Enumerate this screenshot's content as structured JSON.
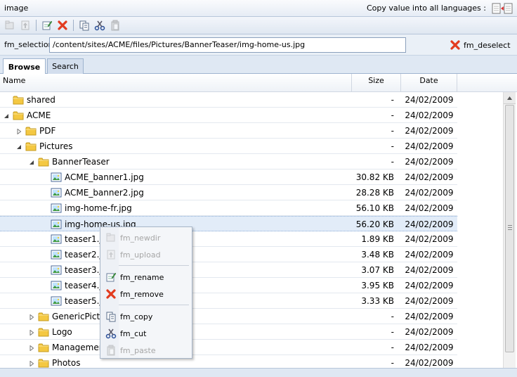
{
  "title": "image",
  "copy_languages_label": "Copy value into all languages :",
  "selection": {
    "label": "fm_selection",
    "value": "/content/sites/ACME/files/Pictures/BannerTeaser/img-home-us.jpg",
    "deselect_label": "fm_deselect"
  },
  "tabs": [
    {
      "label": "Browse"
    },
    {
      "label": "Search"
    }
  ],
  "columns": {
    "name": "Name",
    "size": "Size",
    "date": "Date"
  },
  "rows": [
    {
      "name": "shared",
      "size": "-",
      "date": "24/02/2009",
      "type": "folder",
      "depth": 0,
      "expander": "none"
    },
    {
      "name": "ACME",
      "size": "-",
      "date": "24/02/2009",
      "type": "folder",
      "depth": 0,
      "expander": "expanded"
    },
    {
      "name": "PDF",
      "size": "-",
      "date": "24/02/2009",
      "type": "folder",
      "depth": 1,
      "expander": "collapsed"
    },
    {
      "name": "Pictures",
      "size": "-",
      "date": "24/02/2009",
      "type": "folder",
      "depth": 1,
      "expander": "expanded"
    },
    {
      "name": "BannerTeaser",
      "size": "-",
      "date": "24/02/2009",
      "type": "folder",
      "depth": 2,
      "expander": "expanded"
    },
    {
      "name": "ACME_banner1.jpg",
      "size": "30.82 KB",
      "date": "24/02/2009",
      "type": "image",
      "depth": 3,
      "expander": "none"
    },
    {
      "name": "ACME_banner2.jpg",
      "size": "28.28 KB",
      "date": "24/02/2009",
      "type": "image",
      "depth": 3,
      "expander": "none"
    },
    {
      "name": "img-home-fr.jpg",
      "size": "56.10 KB",
      "date": "24/02/2009",
      "type": "image",
      "depth": 3,
      "expander": "none"
    },
    {
      "name": "img-home-us.jpg",
      "size": "56.20 KB",
      "date": "24/02/2009",
      "type": "image",
      "depth": 3,
      "expander": "none",
      "selected": true
    },
    {
      "name": "teaser1.jpg",
      "size": "1.89 KB",
      "date": "24/02/2009",
      "type": "image",
      "depth": 3,
      "expander": "none"
    },
    {
      "name": "teaser2.jpg",
      "size": "3.48 KB",
      "date": "24/02/2009",
      "type": "image",
      "depth": 3,
      "expander": "none"
    },
    {
      "name": "teaser3.jpg",
      "size": "3.07 KB",
      "date": "24/02/2009",
      "type": "image",
      "depth": 3,
      "expander": "none"
    },
    {
      "name": "teaser4.jpg",
      "size": "3.95 KB",
      "date": "24/02/2009",
      "type": "image",
      "depth": 3,
      "expander": "none"
    },
    {
      "name": "teaser5.jpg",
      "size": "3.33 KB",
      "date": "24/02/2009",
      "type": "image",
      "depth": 3,
      "expander": "none"
    },
    {
      "name": "GenericPictures",
      "size": "-",
      "date": "24/02/2009",
      "type": "folder",
      "depth": 2,
      "expander": "collapsed"
    },
    {
      "name": "Logo",
      "size": "-",
      "date": "24/02/2009",
      "type": "folder",
      "depth": 2,
      "expander": "collapsed"
    },
    {
      "name": "Management",
      "size": "-",
      "date": "24/02/2009",
      "type": "folder",
      "depth": 2,
      "expander": "collapsed"
    },
    {
      "name": "Photos",
      "size": "-",
      "date": "24/02/2009",
      "type": "folder",
      "depth": 2,
      "expander": "collapsed"
    }
  ],
  "context_menu": [
    {
      "label": "fm_newdir",
      "enabled": false,
      "icon": "new-folder-icon"
    },
    {
      "label": "fm_upload",
      "enabled": false,
      "icon": "upload-icon"
    },
    {
      "label": "fm_rename",
      "enabled": true,
      "icon": "rename-icon"
    },
    {
      "label": "fm_remove",
      "enabled": true,
      "icon": "remove-icon"
    },
    {
      "label": "fm_copy",
      "enabled": true,
      "icon": "copy-icon"
    },
    {
      "label": "fm_cut",
      "enabled": true,
      "icon": "cut-icon"
    },
    {
      "label": "fm_paste",
      "enabled": false,
      "icon": "paste-icon"
    }
  ],
  "toolbar_icons": [
    "new-folder-icon",
    "upload-icon",
    "rename-icon",
    "remove-icon",
    "copy-icon",
    "cut-icon",
    "paste-icon"
  ],
  "colors": {
    "accent": "#e23b1f",
    "selection": "#e2ecf8",
    "folder": "#f4c842"
  }
}
